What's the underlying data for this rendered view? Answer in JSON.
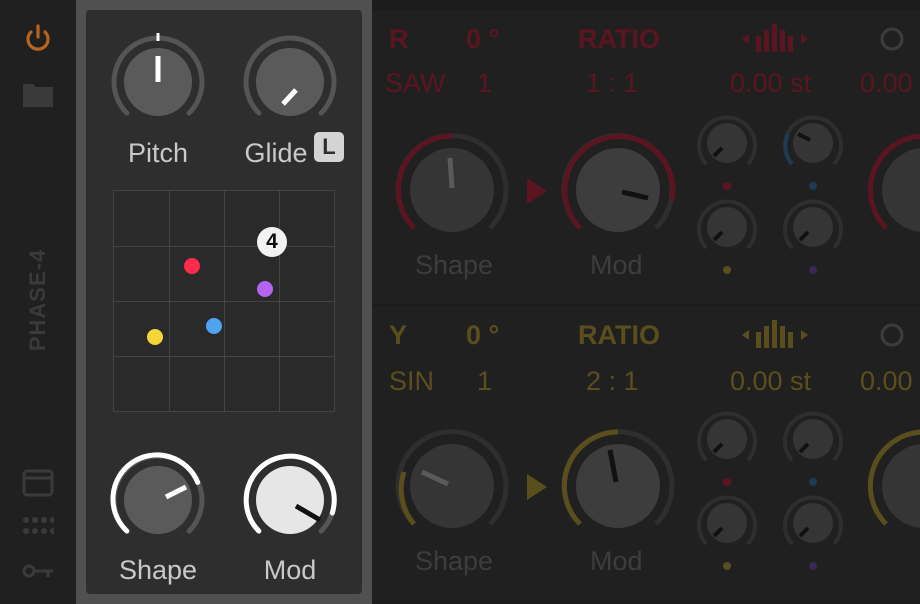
{
  "device": {
    "title": "PHASE-4"
  },
  "panel": {
    "pitch_label": "Pitch",
    "glide_label": "Glide",
    "glide_lock": "L",
    "xy_count": "4",
    "shape_label": "Shape",
    "mod_label": "Mod"
  },
  "osc_r": {
    "channel": "R",
    "phase": "0 °",
    "ratio_label": "RATIO",
    "wave": "SAW",
    "wave_num": "1",
    "ratio": "1 : 1",
    "detune": "0.00 st",
    "edge_value": "0.00",
    "shape_label": "Shape",
    "mod_label": "Mod"
  },
  "osc_y": {
    "channel": "Y",
    "phase": "0 °",
    "ratio_label": "RATIO",
    "wave": "SIN",
    "wave_num": "1",
    "ratio": "2 : 1",
    "detune": "0.00 st",
    "edge_value": "0.00",
    "shape_label": "Shape",
    "mod_label": "Mod"
  },
  "colors": {
    "accent_red": "#ff2a4c",
    "accent_blue": "#4fa3f0",
    "accent_yellow": "#f4d63a",
    "accent_purple": "#b464f0"
  }
}
